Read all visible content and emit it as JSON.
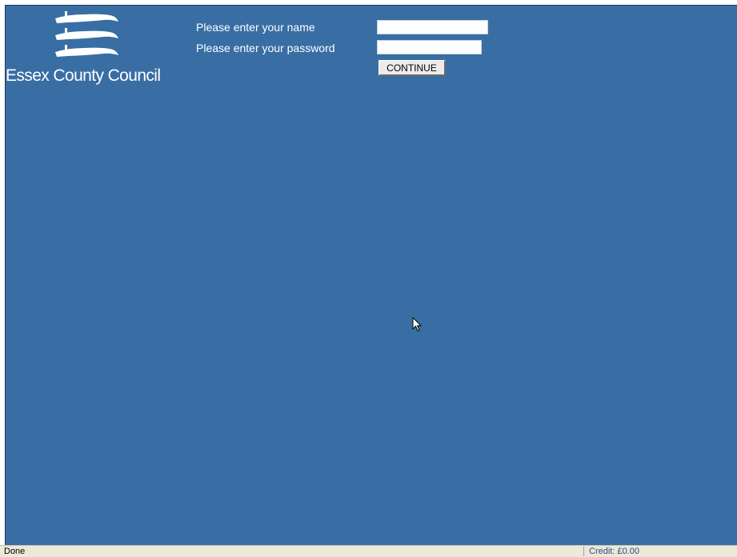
{
  "logo": {
    "text": "Essex County Council",
    "icon": "three-seaxes-icon"
  },
  "login": {
    "name_label": "Please enter your name",
    "name_value": "",
    "password_label": "Please enter your password",
    "password_value": "",
    "continue_label": "CONTINUE"
  },
  "statusbar": {
    "status": "Done",
    "credit": "Credit: £0.00"
  },
  "colors": {
    "background": "#386ea4",
    "text": "#ffffff",
    "statusbar": "#ece9d8"
  }
}
